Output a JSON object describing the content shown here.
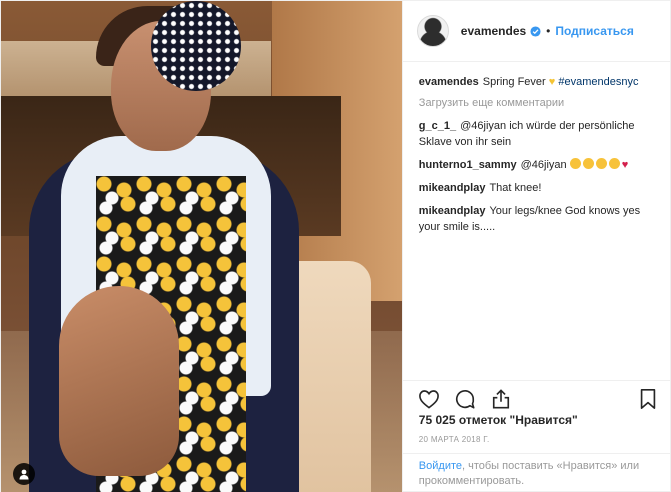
{
  "post": {
    "author": "evamendes",
    "follow_label": "Подписаться",
    "separator": "•",
    "caption": {
      "user": "evamendes",
      "text": "Spring Fever",
      "hashtag": "#evamendesnyc"
    },
    "load_more_label": "Загрузить еще комментарии",
    "comments": [
      {
        "user": "g_c_1_",
        "text": "@46jiyan ich würde der persönliche Sklave von ihr sein"
      },
      {
        "user": "hunterno1_sammy",
        "text": "@46jiyan"
      },
      {
        "user": "mikeandplay",
        "text": "That knee!"
      },
      {
        "user": "mikeandplay",
        "text": "Your legs/knee God knows yes your smile is....."
      }
    ],
    "likes": "75 025 отметок \"Нравится\"",
    "date": "20 МАРТА 2018 Г.",
    "login": {
      "link": "Войдите",
      "text": ", чтобы поставить «Нравится» или прокомментировать."
    }
  },
  "icons": {
    "verified": "verified-badge-icon",
    "like": "heart-icon",
    "comment": "comment-icon",
    "share": "share-icon",
    "save": "bookmark-icon",
    "user_tag": "user-tag-icon"
  },
  "colors": {
    "link": "#3897f0",
    "muted": "#999999",
    "text": "#262626",
    "border": "#efefef"
  }
}
